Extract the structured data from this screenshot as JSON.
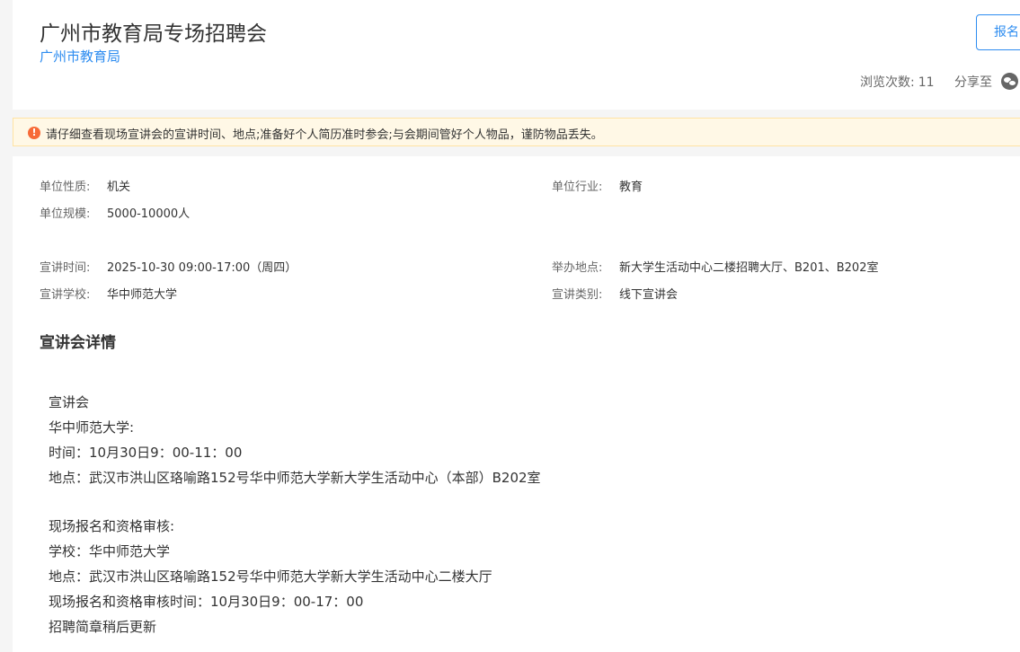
{
  "header": {
    "title": "广州市教育局专场招聘会",
    "organizer": "广州市教育局",
    "signup_label": "报名",
    "views_label": "浏览次数:",
    "views_count": "11",
    "share_label": "分享至"
  },
  "notice": {
    "text": "请仔细查看现场宣讲会的宣讲时间、地点;准备好个人简历准时参会;与会期间管好个人物品，谨防物品丢失。"
  },
  "info": {
    "unit_type_label": "单位性质:",
    "unit_type": "机关",
    "industry_label": "单位行业:",
    "industry": "教育",
    "scale_label": "单位规模:",
    "scale": "5000-10000人",
    "time_label": "宣讲时间:",
    "time": "2025-10-30 09:00-17:00（周四）",
    "location_label": "举办地点:",
    "location": "新大学生活动中心二楼招聘大厅、B201、B202室",
    "school_label": "宣讲学校:",
    "school": "华中师范大学",
    "category_label": "宣讲类别:",
    "category": "线下宣讲会"
  },
  "details": {
    "title": "宣讲会详情",
    "lines": [
      "宣讲会",
      "华中师范大学:",
      "时间：10月30日9：00-11：00",
      "地点：武汉市洪山区珞喻路152号华中师范大学新大学生活动中心（本部）B202室",
      "现场报名和资格审核:",
      "学校：华中师范大学",
      "地点：武汉市洪山区珞喻路152号华中师范大学新大学生活动中心二楼大厅",
      "现场报名和资格审核时间：10月30日9：00-17：00",
      "招聘简章稍后更新"
    ]
  }
}
